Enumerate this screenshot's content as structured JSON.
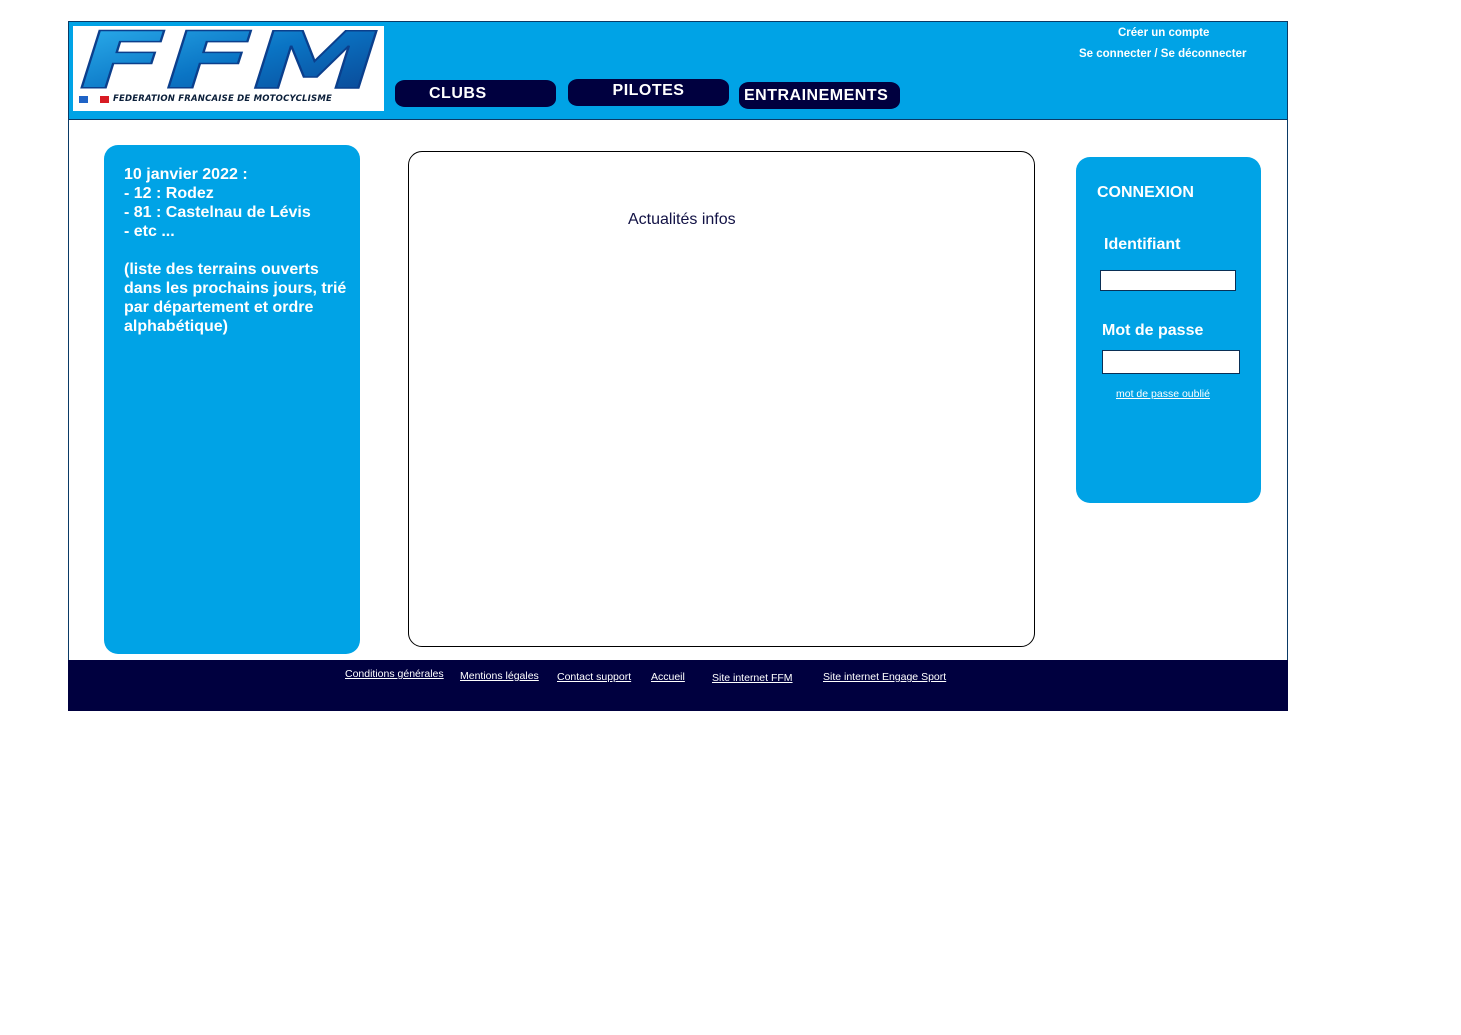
{
  "colors": {
    "primary_blue": "#00a3e6",
    "navy": "#00003f",
    "white": "#ffffff"
  },
  "header": {
    "logo": {
      "letters": "FFM",
      "caption": "FEDERATION FRANCAISE DE MOTOCYCLISME"
    },
    "nav": {
      "clubs": "CLUBS",
      "pilotes": "PILOTES",
      "entrainements": "ENTRAINEMENTS"
    },
    "account_links": {
      "create_account": "Créer un compte",
      "login_logout": "Se connecter / Se déconnecter"
    }
  },
  "left_panel": {
    "text": "10 janvier 2022 :\n- 12 : Rodez\n- 81 : Castelnau de Lévis\n- etc ...\n\n(liste des terrains ouverts dans les  prochains jours, trié par département et ordre alphabétique)"
  },
  "center_panel": {
    "title": "Actualités infos"
  },
  "login_panel": {
    "title": "CONNEXION",
    "identifier_label": "Identifiant",
    "identifier_value": "",
    "password_label": "Mot de passe",
    "password_value": "",
    "forgot_password": "mot de passe oublié"
  },
  "footer": {
    "links": {
      "conditions": "Conditions générales",
      "mentions": "Mentions légales",
      "contact": "Contact support",
      "accueil": "Accueil",
      "site_ffm": "Site internet FFM",
      "site_engage": "Site internet Engage Sport"
    }
  }
}
